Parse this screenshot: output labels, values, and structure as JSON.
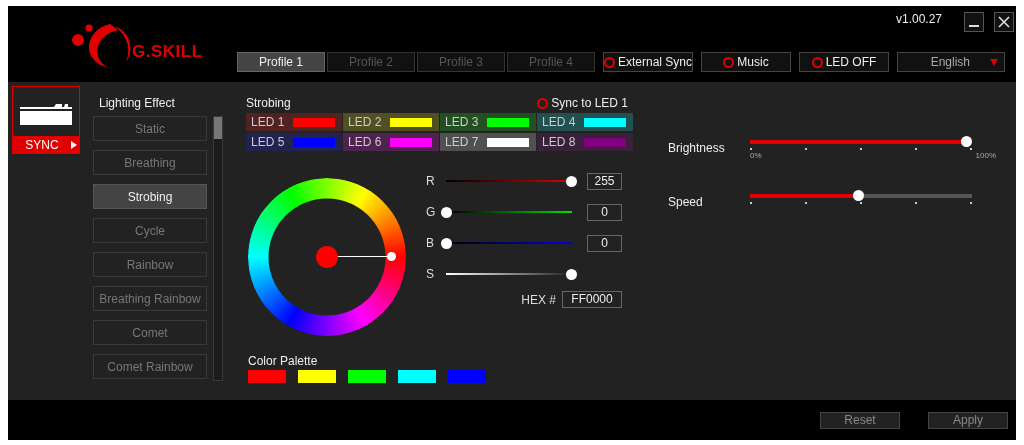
{
  "window": {
    "logo": "G.SKILL",
    "version": "v1.00.27"
  },
  "profiles": [
    {
      "label": "Profile 1",
      "selected": true
    },
    {
      "label": "Profile 2",
      "selected": false
    },
    {
      "label": "Profile 3",
      "selected": false
    },
    {
      "label": "Profile 4",
      "selected": false
    }
  ],
  "toggles": [
    {
      "label": "External Sync",
      "on": false
    },
    {
      "label": "Music",
      "on": false
    },
    {
      "label": "LED OFF",
      "on": false
    }
  ],
  "language": "English",
  "device": {
    "label": "SYNC",
    "selected": true
  },
  "lighting_effect": {
    "title": "Lighting Effect",
    "effects": [
      {
        "label": "Static",
        "selected": false
      },
      {
        "label": "Breathing",
        "selected": false
      },
      {
        "label": "Strobing",
        "selected": true
      },
      {
        "label": "Cycle",
        "selected": false
      },
      {
        "label": "Rainbow",
        "selected": false
      },
      {
        "label": "Breathing Rainbow",
        "selected": false
      },
      {
        "label": "Comet",
        "selected": false
      },
      {
        "label": "Comet Rainbow",
        "selected": false
      }
    ]
  },
  "panel": {
    "title": "Strobing",
    "sync": {
      "label": "Sync to LED 1",
      "on": false
    }
  },
  "leds": [
    {
      "label": "LED 1",
      "color": "#ff0000"
    },
    {
      "label": "LED 2",
      "color": "#ffff00"
    },
    {
      "label": "LED 3",
      "color": "#00ff00"
    },
    {
      "label": "LED 4",
      "color": "#00ffff"
    },
    {
      "label": "LED 5",
      "color": "#0000ff"
    },
    {
      "label": "LED 6",
      "color": "#ff00ff"
    },
    {
      "label": "LED 7",
      "color": "#ffffff"
    },
    {
      "label": "LED 8",
      "color": "#800080"
    }
  ],
  "channels": [
    {
      "label": "R",
      "kind": "red",
      "level": 1,
      "value": "255"
    },
    {
      "label": "G",
      "kind": "green",
      "level": 0,
      "value": "0"
    },
    {
      "label": "B",
      "kind": "blue",
      "level": 0,
      "value": "0"
    },
    {
      "label": "S",
      "kind": "saturation",
      "level": 1
    }
  ],
  "hex": {
    "label": "HEX #",
    "value": "FF0000"
  },
  "palette": {
    "title": "Color Palette",
    "colors": [
      {
        "color": "#ff0000"
      },
      {
        "color": "#ffff00"
      },
      {
        "color": "#00ff00"
      },
      {
        "color": "#00ffff"
      },
      {
        "color": "#0000ff"
      }
    ]
  },
  "brightness": {
    "label": "Brightness",
    "level": 1,
    "min_label": "0%",
    "max_label": "100%"
  },
  "speed": {
    "label": "Speed",
    "level": 0.49
  },
  "buttons": [
    "Reset",
    "Apply"
  ]
}
